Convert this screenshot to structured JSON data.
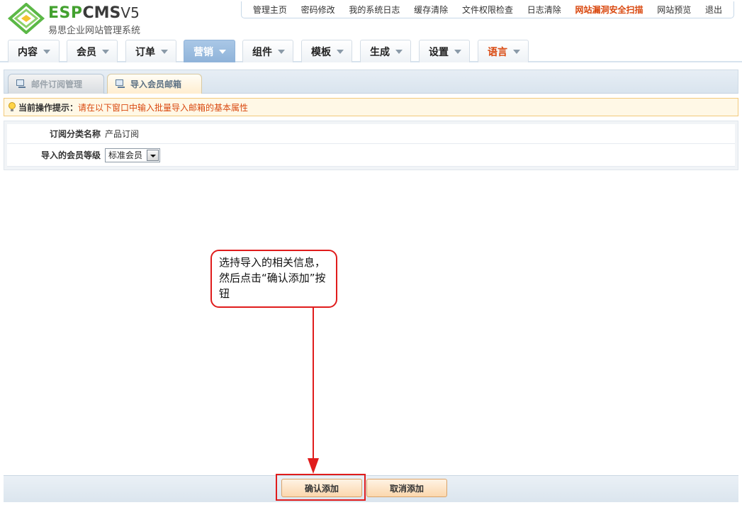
{
  "logo": {
    "brand_esp": "ESP",
    "brand_cms": "CMS",
    "brand_version": "V5",
    "subtitle": "易思企业网站管理系统"
  },
  "top_links": [
    {
      "label": "管理主页"
    },
    {
      "label": "密码修改"
    },
    {
      "label": "我的系统日志"
    },
    {
      "label": "缓存清除"
    },
    {
      "label": "文件权限检查"
    },
    {
      "label": "日志清除"
    },
    {
      "label": "网站漏洞安全扫描"
    },
    {
      "label": "网站预览"
    },
    {
      "label": "退出"
    }
  ],
  "nav": {
    "items": [
      {
        "label": "内容"
      },
      {
        "label": "会员"
      },
      {
        "label": "订单"
      },
      {
        "label": "营销"
      },
      {
        "label": "组件"
      },
      {
        "label": "模板"
      },
      {
        "label": "生成"
      },
      {
        "label": "设置"
      },
      {
        "label": "语言"
      }
    ],
    "active": "营销"
  },
  "tabs": [
    {
      "label": "邮件订阅管理"
    },
    {
      "label": "导入会员邮箱"
    }
  ],
  "hint": {
    "label": "当前操作提示：",
    "text": "请在以下窗口中输入批量导入邮箱的基本属性"
  },
  "form": {
    "category_label": "订阅分类名称",
    "category_value": "产品订阅",
    "level_label": "导入的会员等级",
    "level_value": "标准会员"
  },
  "callout": {
    "text": "选持导入的相关信息，然后点击“确认添加”按钮"
  },
  "buttons": {
    "confirm": "确认添加",
    "cancel": "取消添加"
  },
  "colors": {
    "accent_red": "#e01c1c",
    "warning_orange": "#d9480f",
    "brand_green": "#43a12f"
  }
}
